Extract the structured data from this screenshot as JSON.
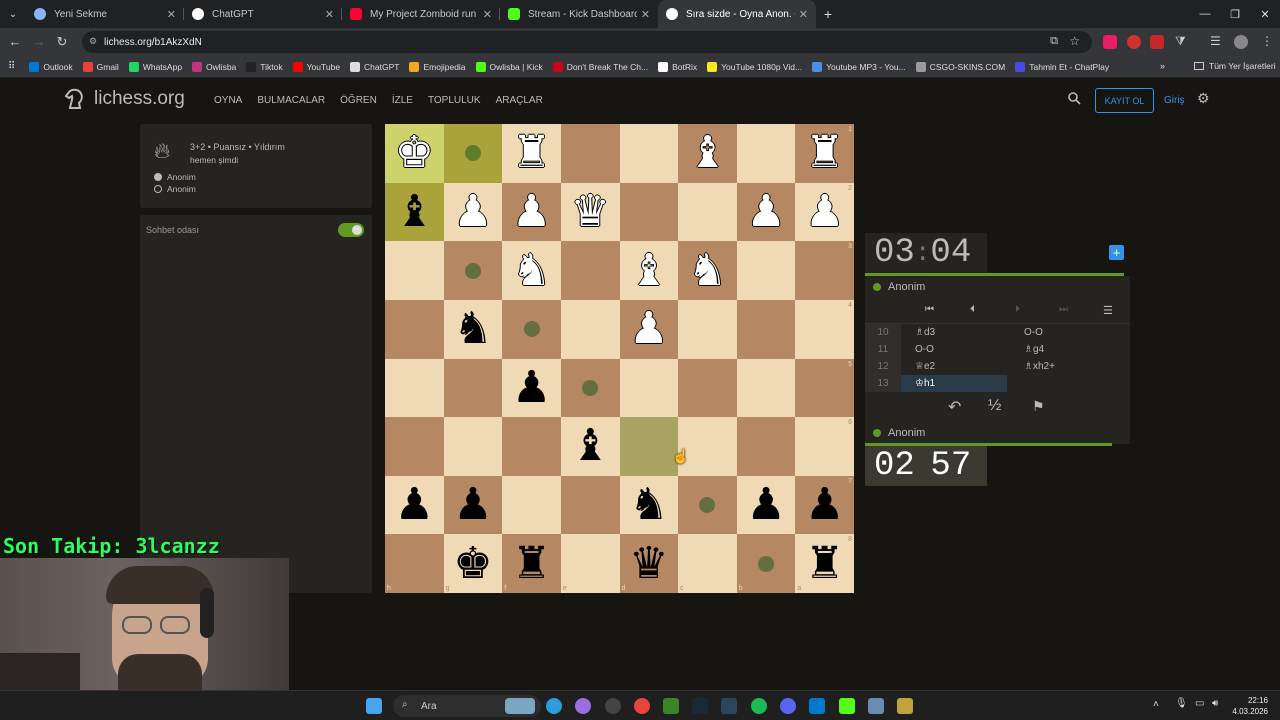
{
  "browser": {
    "tabs": [
      {
        "title": "Yeni Sekme",
        "color": "#8ab4f8"
      },
      {
        "title": "ChatGPT",
        "color": "#ffffff"
      },
      {
        "title": "My Project Zomboid run ENDE",
        "color": "#ff0033"
      },
      {
        "title": "Stream - Kick Dashboard",
        "color": "#53fc18"
      },
      {
        "title": "Sıra sizde - Oyna Anon. • liches",
        "color": "#ffffff"
      }
    ],
    "active_tab": 4,
    "url": "lichess.org/b1AkzXdN",
    "bookmarks": [
      {
        "label": "Outlook",
        "color": "#0078d4"
      },
      {
        "label": "Gmail",
        "color": "#ea4335"
      },
      {
        "label": "WhatsApp",
        "color": "#25d366"
      },
      {
        "label": "Owlisba",
        "color": "#c13584"
      },
      {
        "label": "Tiktok",
        "color": "#222222"
      },
      {
        "label": "YouTube",
        "color": "#ff0000"
      },
      {
        "label": "ChatGPT",
        "color": "#dddddd"
      },
      {
        "label": "Emojipedia",
        "color": "#f5a623"
      },
      {
        "label": "Owlisba | Kick",
        "color": "#53fc18"
      },
      {
        "label": "Don't Break The Ch...",
        "color": "#d0021b"
      },
      {
        "label": "BotRix",
        "color": "#ffffff"
      },
      {
        "label": "YouTube 1080p Vid...",
        "color": "#f8e71c"
      },
      {
        "label": "Youtube MP3 - You...",
        "color": "#4a90e2"
      },
      {
        "label": "CSGO-SKINS.COM",
        "color": "#9b9b9b"
      },
      {
        "label": "Tahmin Et - ChatPlay",
        "color": "#4a4ae2"
      }
    ],
    "bookmarks_all": "Tüm Yer İşaretleri"
  },
  "site": {
    "logo_text": "lichess.org",
    "nav": [
      "OYNA",
      "BULMACALAR",
      "ÖĞREN",
      "İZLE",
      "TOPLULUK",
      "ARAÇLAR"
    ],
    "signup": "KAYIT OL",
    "login": "Giriş"
  },
  "game": {
    "info": "3+2 • Puansız • Yıldırım",
    "time_ago": "hemen şimdi",
    "white_player": "Anonim",
    "black_player": "Anonim",
    "chat_label": "Sohbet odası"
  },
  "board": {
    "orientation": "black",
    "ranks": [
      "1",
      "2",
      "3",
      "4",
      "5",
      "6",
      "7",
      "8"
    ],
    "files": [
      "h",
      "g",
      "f",
      "e",
      "d",
      "c",
      "b",
      "a"
    ],
    "squares": [
      [
        "wK:hl",
        "dot:hd",
        "wR",
        "",
        "",
        "wB",
        "",
        "wR"
      ],
      [
        "bB:hd",
        "wP",
        "wP",
        "wQ",
        "",
        "",
        "wP",
        "wP"
      ],
      [
        "",
        "dot",
        "wN",
        "",
        "wB",
        "wN",
        "",
        ""
      ],
      [
        "",
        "bN",
        "dot",
        "",
        "wP",
        "",
        "",
        ""
      ],
      [
        "",
        "",
        "bP",
        "dot",
        "",
        "",
        "",
        ""
      ],
      [
        "",
        "",
        "",
        "bB",
        "lm",
        "",
        "",
        ""
      ],
      [
        "bP",
        "bP",
        "",
        "",
        "bN",
        "dot",
        "bP",
        "bP"
      ],
      [
        "",
        "bK",
        "bR",
        "",
        "bQ",
        "",
        "dot",
        "bR"
      ]
    ]
  },
  "clocks": {
    "top": {
      "min": "03",
      "sec": "04",
      "player": "Anonim"
    },
    "bottom": {
      "min": "02",
      "sec": "57",
      "player": "Anonim"
    }
  },
  "moves": [
    {
      "n": "10",
      "w": "♗d3",
      "b": "O-O"
    },
    {
      "n": "11",
      "w": "O-O",
      "b": "♗g4"
    },
    {
      "n": "12",
      "w": "♕e2",
      "b": "♗xh2+"
    },
    {
      "n": "13",
      "w": "♔h1",
      "b": ""
    }
  ],
  "actions": {
    "takeback": "↶",
    "draw": "½",
    "resign": "⚑"
  },
  "overlay": {
    "text": "Son Takip: 3lcanzz"
  },
  "taskbar": {
    "search": "Ara",
    "time": "22:16",
    "date": "4.03.2026"
  }
}
